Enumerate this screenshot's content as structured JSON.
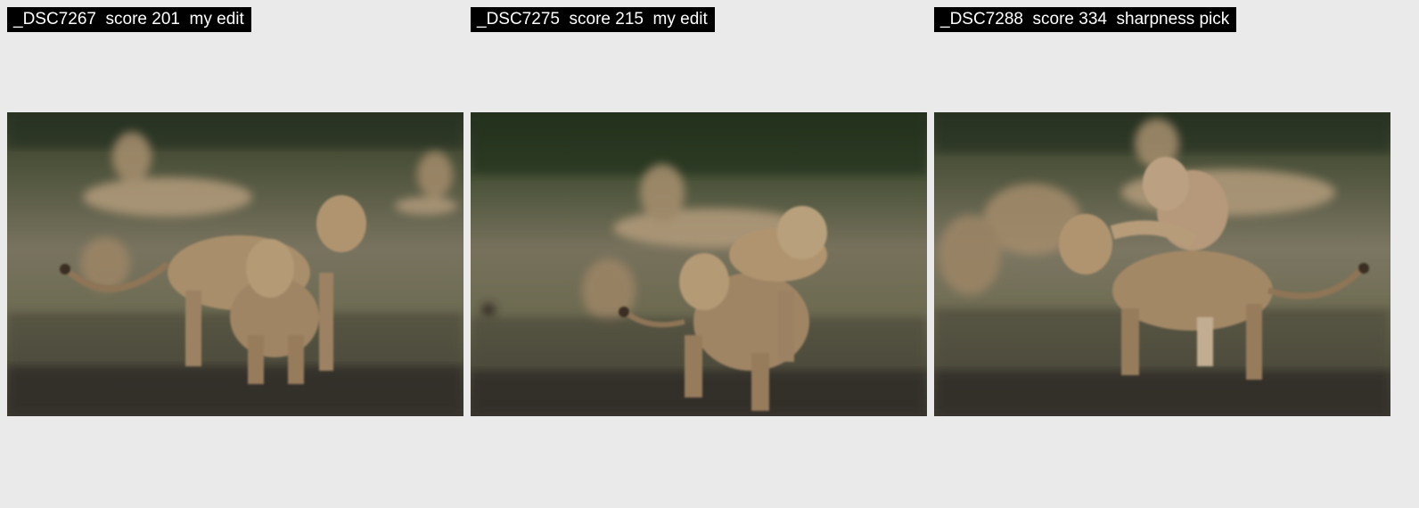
{
  "thumbnails": [
    {
      "filename": "_DSC7267",
      "score_text": "score 201",
      "tag": "my edit"
    },
    {
      "filename": "_DSC7275",
      "score_text": "score 215",
      "tag": "my edit"
    },
    {
      "filename": "_DSC7288",
      "score_text": "score 334",
      "tag": "sharpness pick"
    }
  ],
  "colors": {
    "background": "#eaeaea",
    "label_bg": "#000000",
    "label_text": "#ffffff"
  }
}
